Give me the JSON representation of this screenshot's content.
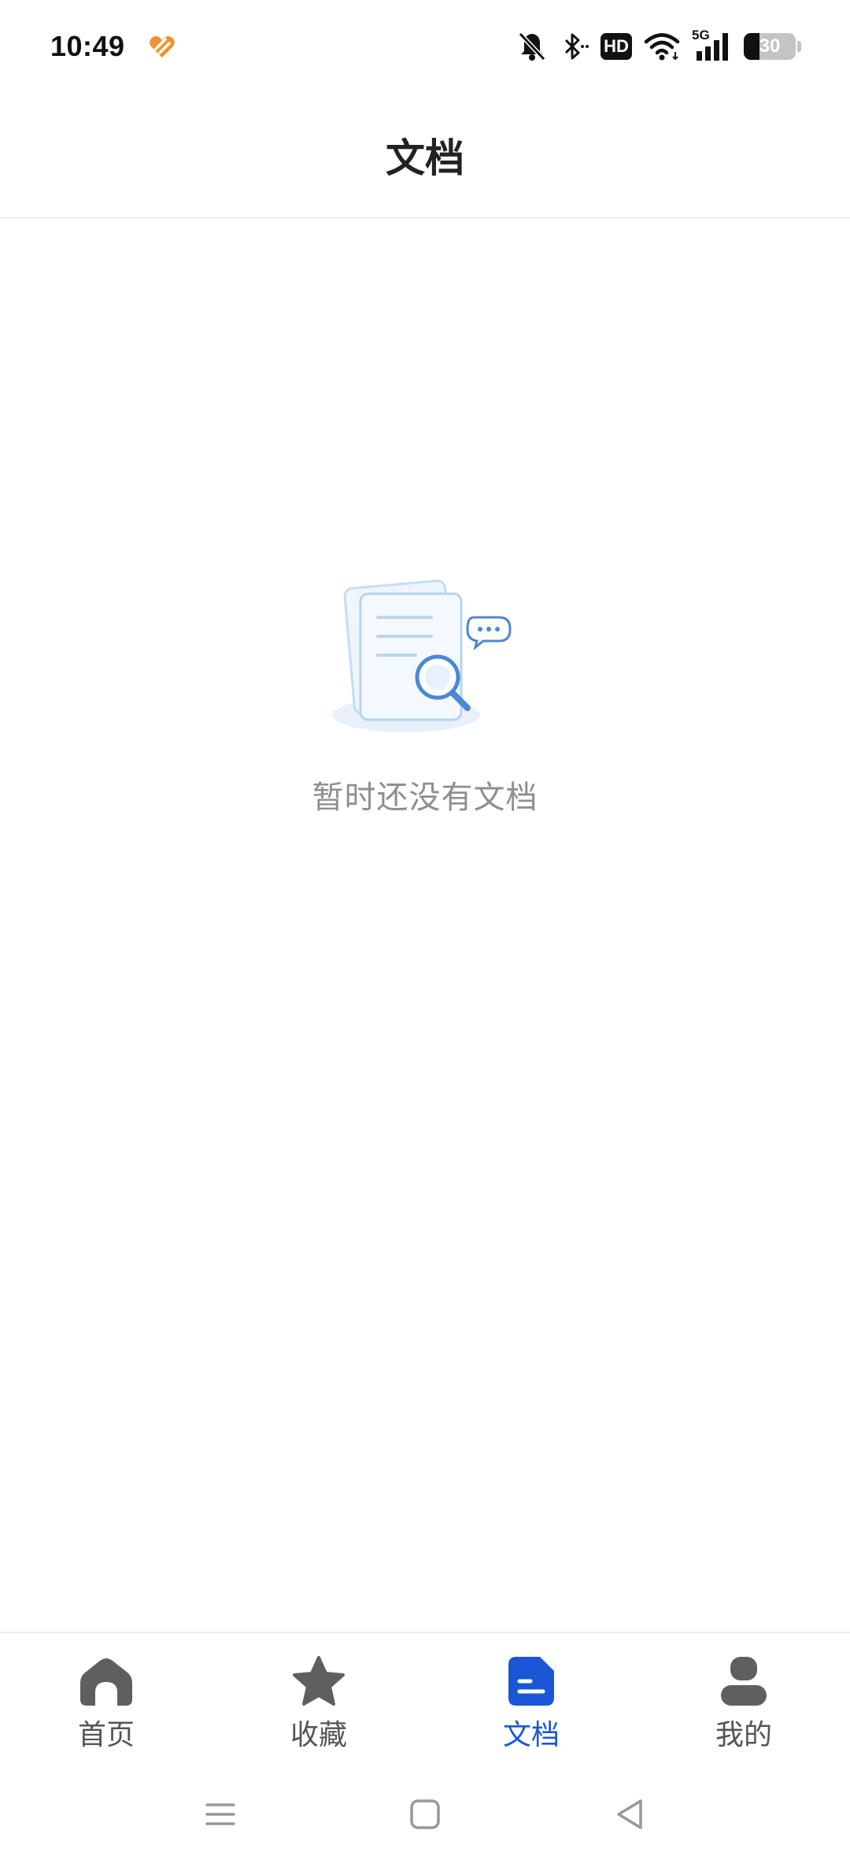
{
  "status_bar": {
    "time": "10:49",
    "app_icon": "orange-heart-app-icon",
    "icons": [
      "bell-muted-icon",
      "bluetooth-icon",
      "hd-icon",
      "wifi-icon",
      "signal-5g-icon",
      "battery-icon"
    ],
    "hd_label": "HD",
    "network_label": "5G",
    "battery_level": "30"
  },
  "header": {
    "title": "文档"
  },
  "empty_state": {
    "illustration": "document-search-illustration",
    "message": "暂时还没有文档"
  },
  "tabs": [
    {
      "label": "首页",
      "icon": "home-icon",
      "active": false
    },
    {
      "label": "收藏",
      "icon": "star-icon",
      "active": false
    },
    {
      "label": "文档",
      "icon": "document-icon",
      "active": true
    },
    {
      "label": "我的",
      "icon": "profile-icon",
      "active": false
    }
  ],
  "system_nav": [
    "menu-icon",
    "home-square-icon",
    "back-icon"
  ],
  "colors": {
    "accent": "#1a57d6",
    "inactive_icon": "#5f5f5f",
    "empty_text": "#8f8f8f",
    "app_icon": "#f0912f"
  }
}
